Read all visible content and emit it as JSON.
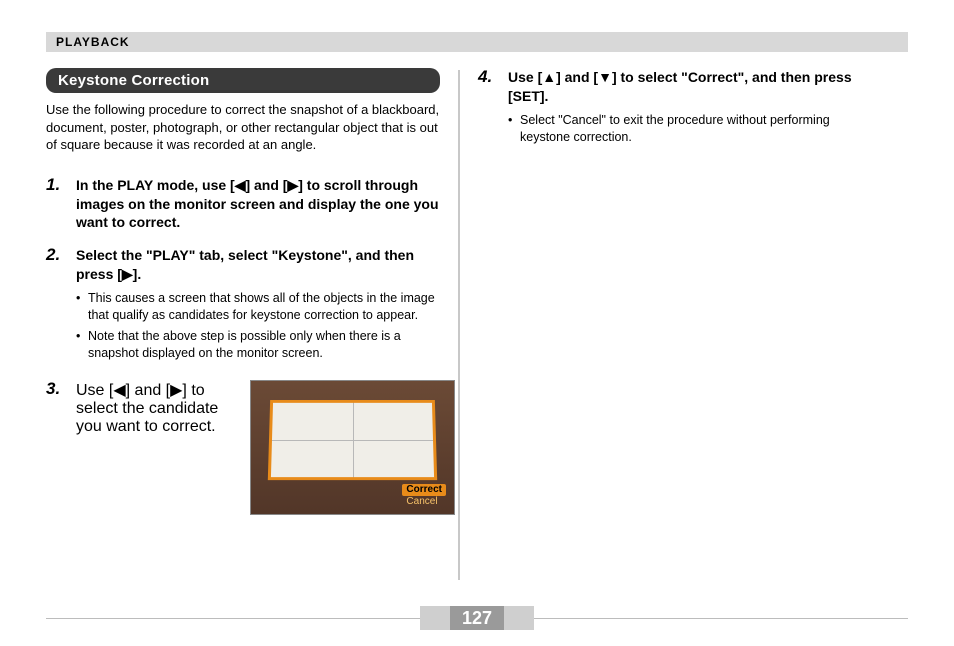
{
  "header": {
    "section": "PLAYBACK"
  },
  "title": "Keystone Correction",
  "intro": "Use the following procedure to correct the snapshot of a blackboard, document, poster, photograph, or other rectangular object that is out of square because it was recorded at an angle.",
  "steps": {
    "s1": {
      "num": "1.",
      "lead": "In the PLAY mode, use [◀] and [▶] to scroll through images on the monitor screen and display the one you want to correct."
    },
    "s2": {
      "num": "2.",
      "lead": "Select the \"PLAY\" tab, select \"Keystone\", and then press [▶].",
      "b1": "This causes a screen that shows all of the objects in the image that qualify as candidates for keystone correction to appear.",
      "b2": "Note that the above step is possible only when there is a snapshot displayed on the monitor screen."
    },
    "s3": {
      "num": "3.",
      "lead": "Use [◀] and [▶] to select the candidate you want to correct."
    },
    "s4": {
      "num": "4.",
      "lead": "Use [▲] and [▼] to select \"Correct\", and then press [SET].",
      "b1": "Select \"Cancel\" to exit the procedure without performing keystone correction."
    }
  },
  "screenshot": {
    "correct": "Correct",
    "cancel": "Cancel"
  },
  "page_number": "127"
}
